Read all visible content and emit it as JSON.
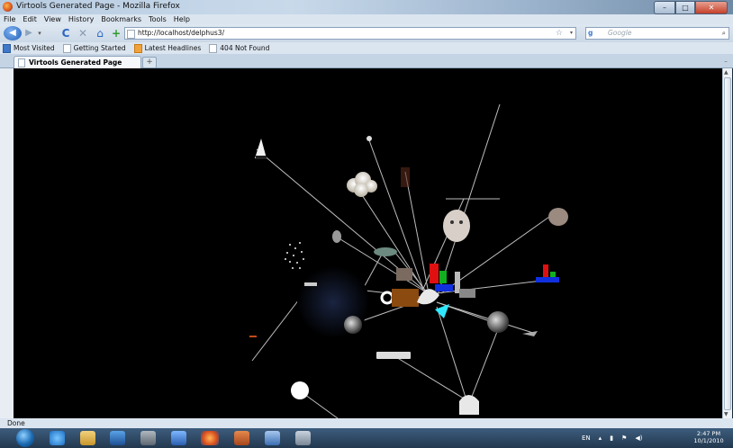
{
  "window": {
    "title": "Virtools Generated Page - Mozilla Firefox",
    "controls": {
      "minimize": "–",
      "maximize": "□",
      "close": "✕"
    }
  },
  "menu": [
    "File",
    "Edit",
    "View",
    "History",
    "Bookmarks",
    "Tools",
    "Help"
  ],
  "nav": {
    "back": "◀",
    "forward": "▶",
    "dropdown": "▾",
    "reload": "C",
    "stop": "✕",
    "home": "⌂",
    "add": "+",
    "url": "http://localhost/delphus3/",
    "star": "☆",
    "search_engine": "g",
    "search_placeholder": "Google",
    "search_go": "⌕"
  },
  "bookmarks": [
    "Most Visited",
    "Getting Started",
    "Latest Headlines",
    "404 Not Found"
  ],
  "tabs": {
    "active_label": "Virtools Generated Page",
    "new_tab": "+",
    "list": "–"
  },
  "status": "Done",
  "tray": {
    "lang": "EN",
    "clock_time": "2:47 PM",
    "clock_date": "10/1/2010"
  },
  "colors": {
    "scene_bg": "#000000",
    "line": "#cccccc",
    "accent_red": "#e01010",
    "accent_blue": "#1030e0",
    "accent_green": "#10b020",
    "accent_cyan": "#30e8ff"
  }
}
